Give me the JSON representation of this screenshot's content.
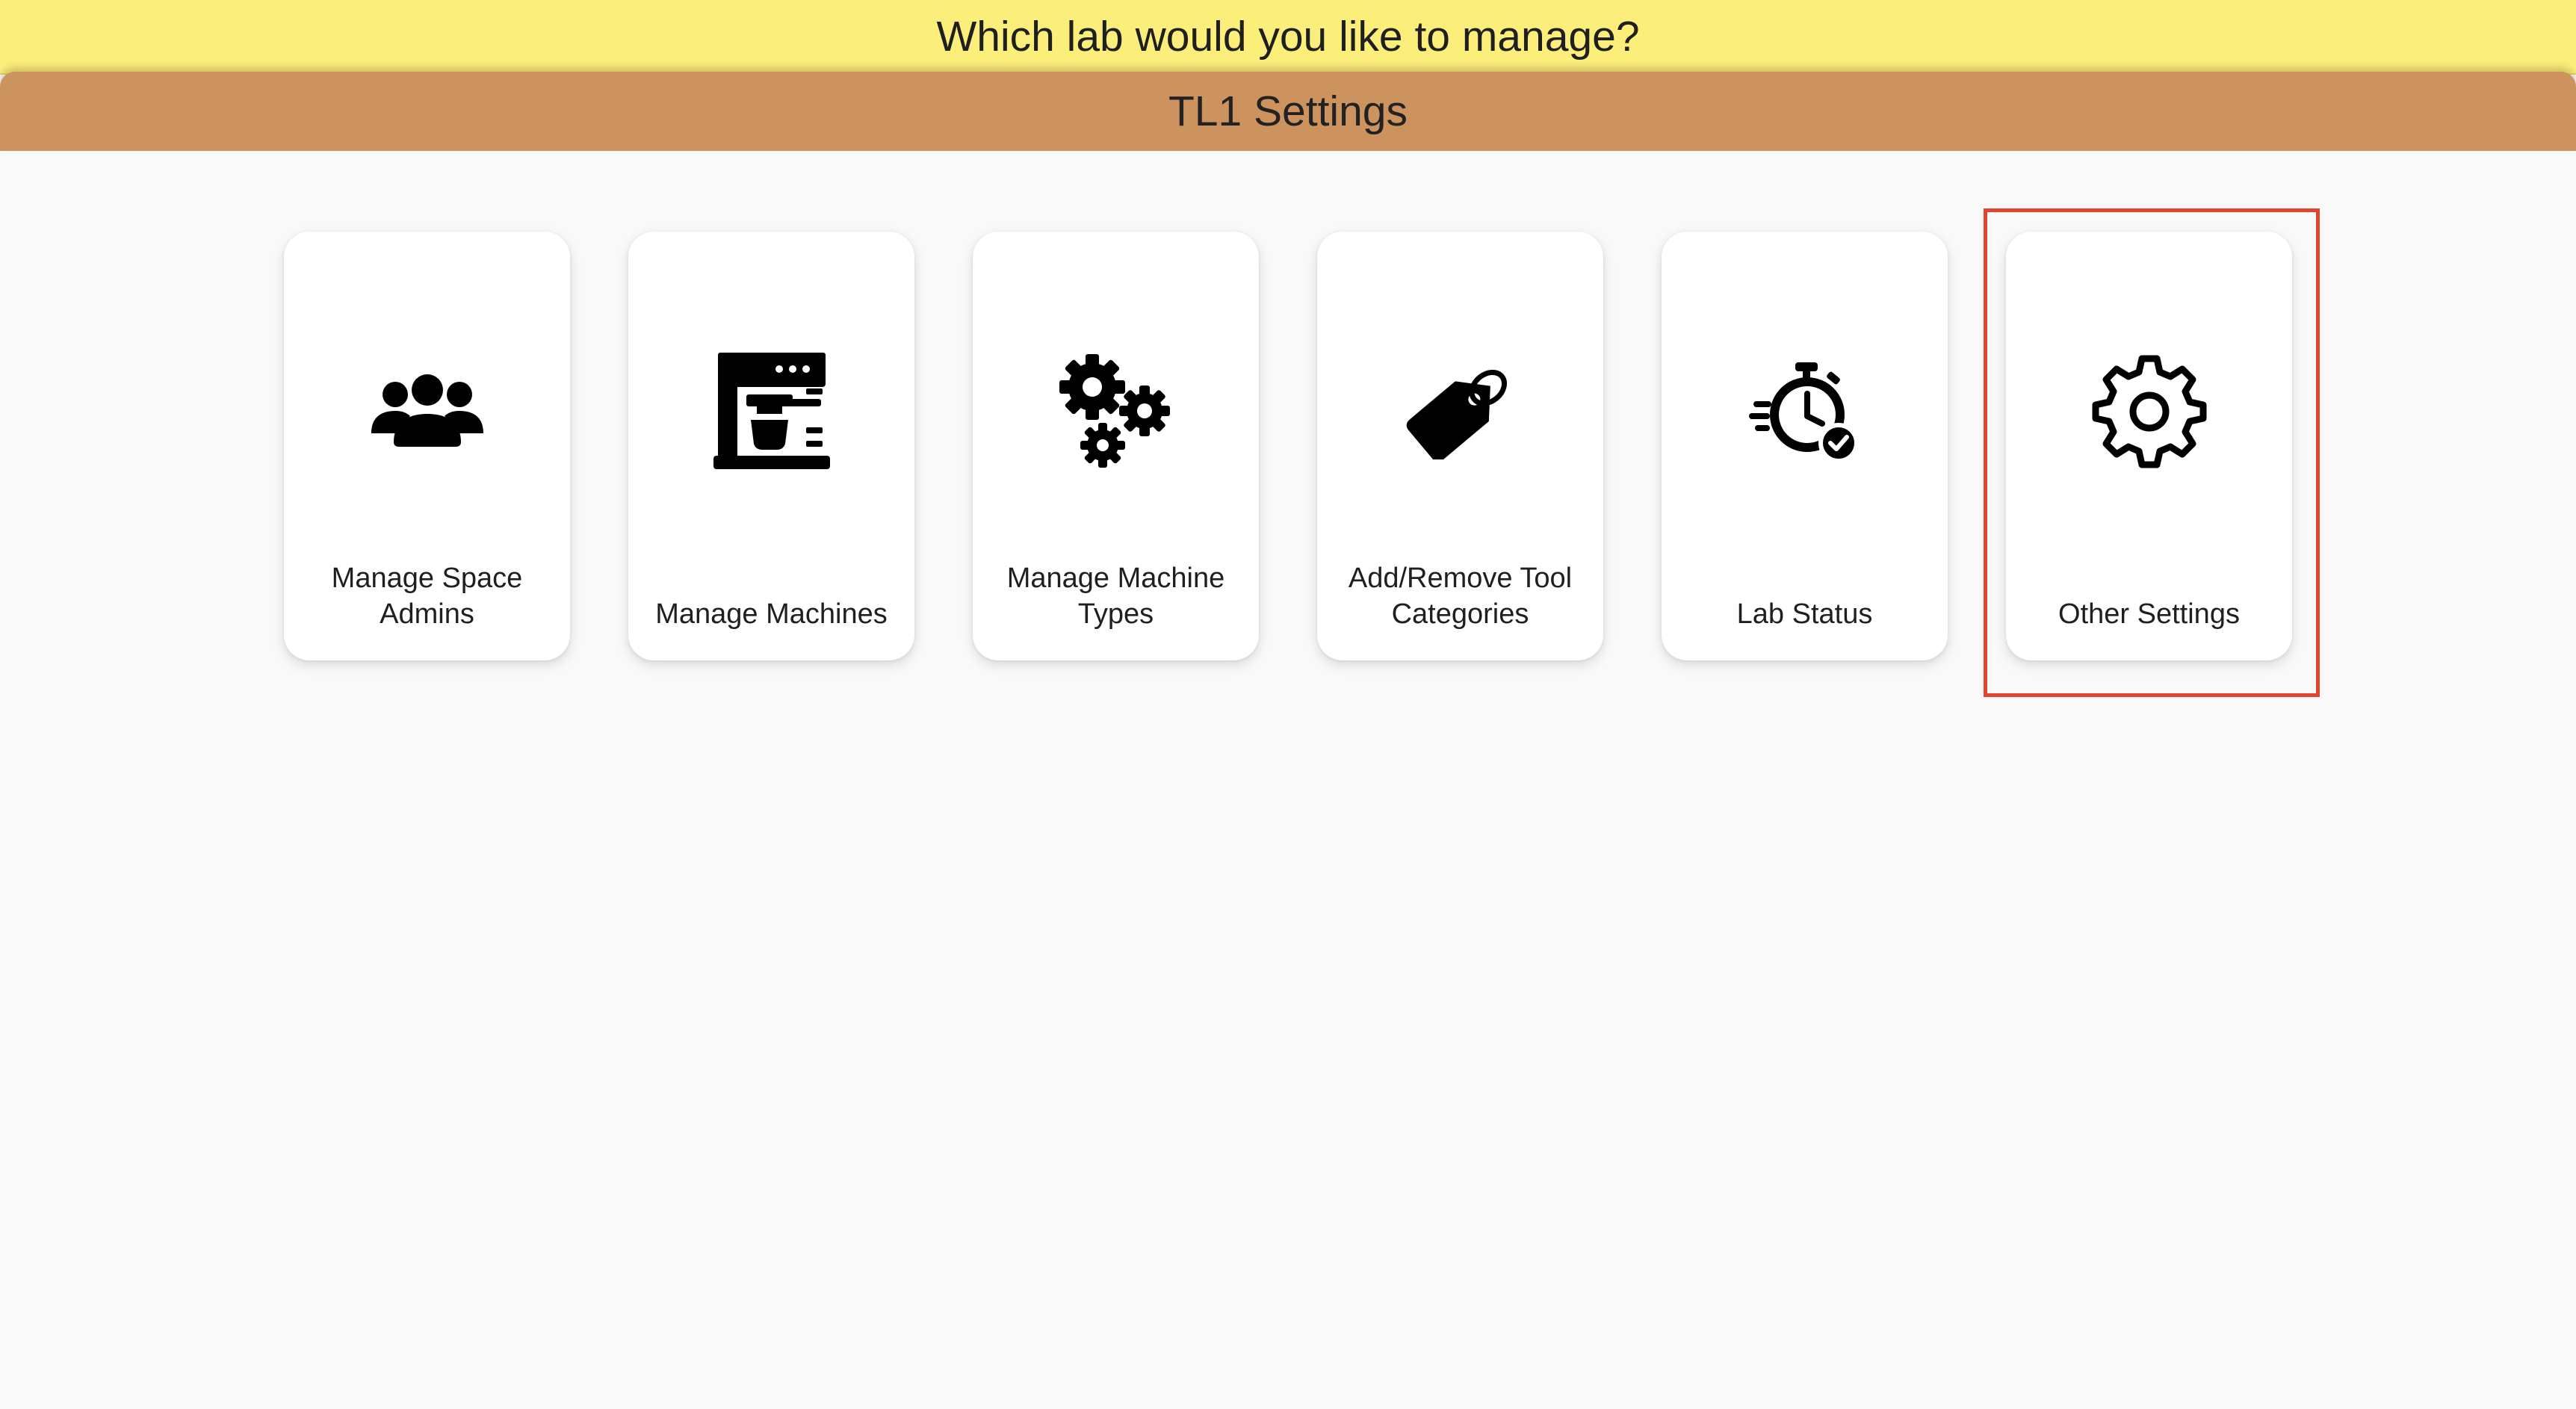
{
  "banner": {
    "title": "Which lab would you like to manage?"
  },
  "settings_bar": {
    "title": "TL1 Settings"
  },
  "cards": [
    {
      "label": "Manage Space Admins",
      "icon": "users-icon"
    },
    {
      "label": "Manage Machines",
      "icon": "espresso-machine-icon"
    },
    {
      "label": "Manage Machine Types",
      "icon": "gears-icon"
    },
    {
      "label": "Add/Remove Tool Categories",
      "icon": "tag-icon"
    },
    {
      "label": "Lab Status",
      "icon": "stopwatch-check-icon"
    },
    {
      "label": "Other Settings",
      "icon": "gear-outline-icon"
    }
  ],
  "colors": {
    "banner_bg": "#fcee7a",
    "settings_bar_bg": "#cd935f",
    "page_bg": "#f9f9f9",
    "card_bg": "#ffffff",
    "highlight": "#e2452f"
  }
}
